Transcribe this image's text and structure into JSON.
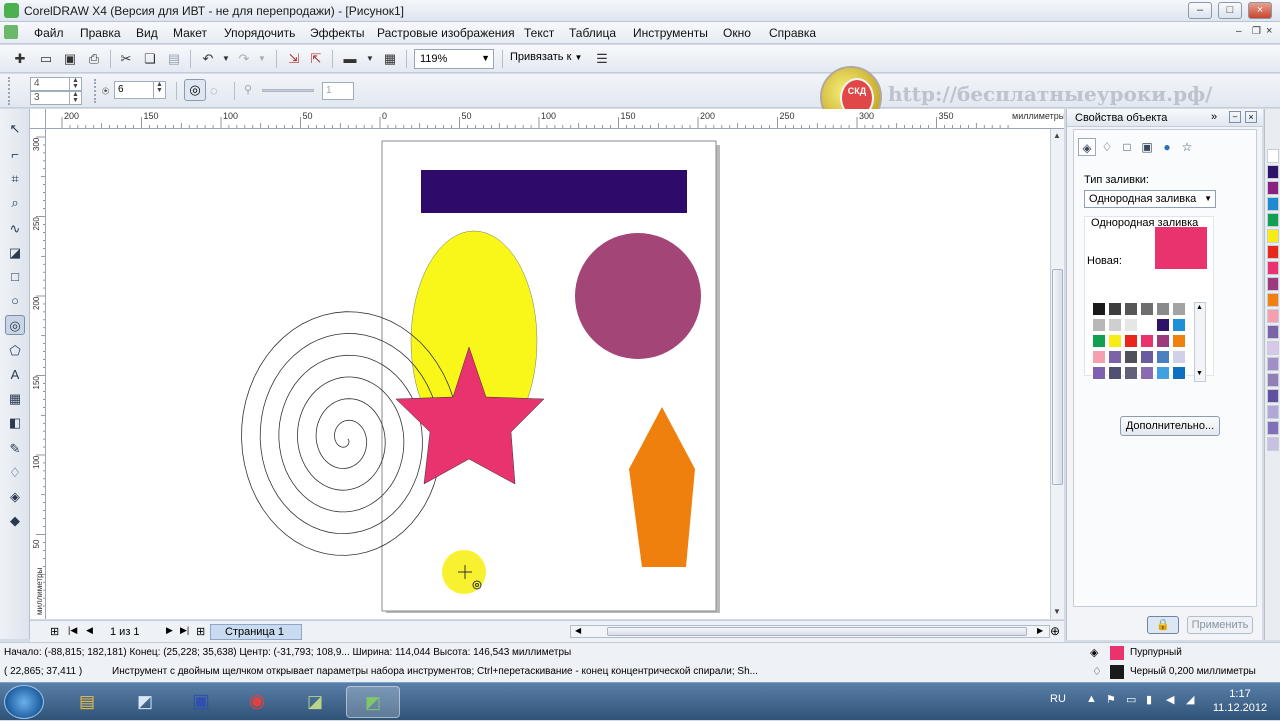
{
  "window": {
    "title": "CorelDRAW X4 (Версия для ИВТ - не для перепродажи) - [Рисунок1]",
    "controls": [
      "–",
      "□",
      "×"
    ]
  },
  "menu": [
    "Файл",
    "Правка",
    "Вид",
    "Макет",
    "Упорядочить",
    "Эффекты",
    "Растровые изображения",
    "Текст",
    "Таблица",
    "Инструменты",
    "Окно",
    "Справка"
  ],
  "toolbar": {
    "zoom": "119%",
    "snap_label": "Привязать к"
  },
  "property_bar": {
    "field_a": "4",
    "field_b": "3",
    "revolutions": "6",
    "expansion": "1"
  },
  "watermark": {
    "badge": "СКД",
    "url": "http://бесплатныеуроки.рф/"
  },
  "rulers": {
    "h_ticks": [
      "200",
      "150",
      "100",
      "50",
      "0",
      "50",
      "100",
      "150",
      "200",
      "250",
      "300",
      "350"
    ],
    "h_unit": "миллиметры",
    "v_ticks": [
      "300",
      "250",
      "200",
      "150",
      "100",
      "50"
    ],
    "v_unit": "миллиметры"
  },
  "page_nav": {
    "counter": "1 из 1",
    "tab": "Страница 1"
  },
  "docker": {
    "title": "Свойства объекта",
    "fill_type_label": "Тип заливки:",
    "fill_type_value": "Однородная заливка",
    "uniform_label": "Однородная заливка",
    "new_label": "Новая:",
    "new_color": "#e8336e",
    "more_button": "Дополнительно...",
    "apply_button": "Применить",
    "palette": [
      "#1a1a1a",
      "#3d3d3d",
      "#575757",
      "#6e6e6e",
      "#8a8a8a",
      "#a3a3a3",
      "#b8b8b8",
      "#cfcfcf",
      "#e6e6e6",
      "#ffffff",
      "#2e1466",
      "#1e90d8",
      "#10a050",
      "#f7ec13",
      "#e8261c",
      "#e8336e",
      "#9b3a7d",
      "#f08010",
      "#f4a0b0",
      "#7b63a8",
      "#50505a",
      "#6a5aa0",
      "#4a80c0",
      "#d0d0e8",
      "#8060b0",
      "#505070",
      "#606078",
      "#8a6ab0",
      "#40a0e0",
      "#1070c0"
    ]
  },
  "colorbar": [
    "#ffffff",
    "#2e1466",
    "#8a2080",
    "#1e8ad0",
    "#10a050",
    "#f7ec13",
    "#e8261c",
    "#e8336e",
    "#9b3a7d",
    "#f08010",
    "#f4a0b0",
    "#7b63a8",
    "#d8c8e8",
    "#a090c8",
    "#9080b8",
    "#6050a0",
    "#b0a8d8",
    "#8070b8",
    "#c8c0e0"
  ],
  "canvas": {
    "rect_color": "#2e0a6b",
    "ellipse_color": "#f9f61a",
    "circle_color": "#a34577",
    "star_color": "#e8336e",
    "pentagon_color": "#f0800d"
  },
  "status": {
    "line1": "Начало: (-88,815; 182,181)  Конец: (25,228; 35,638)  Центр: (-31,793; 108,9...  Ширина: 114,044  Высота: 146,543  миллиметры",
    "coords": "( 22,865; 37,411 )",
    "hint": "Инструмент с двойным щелчком открывает параметры набора инструментов; Ctrl+перетаскивание - конец концентрической спирали; Sh...",
    "fill_name": "Пурпурный",
    "fill_color": "#e8336e",
    "outline_text": "Черный  0,200 миллиметры",
    "outline_color": "#1a1a1a"
  },
  "taskbar": {
    "lang": "RU",
    "time": "1:17",
    "date": "11.12.2012"
  }
}
